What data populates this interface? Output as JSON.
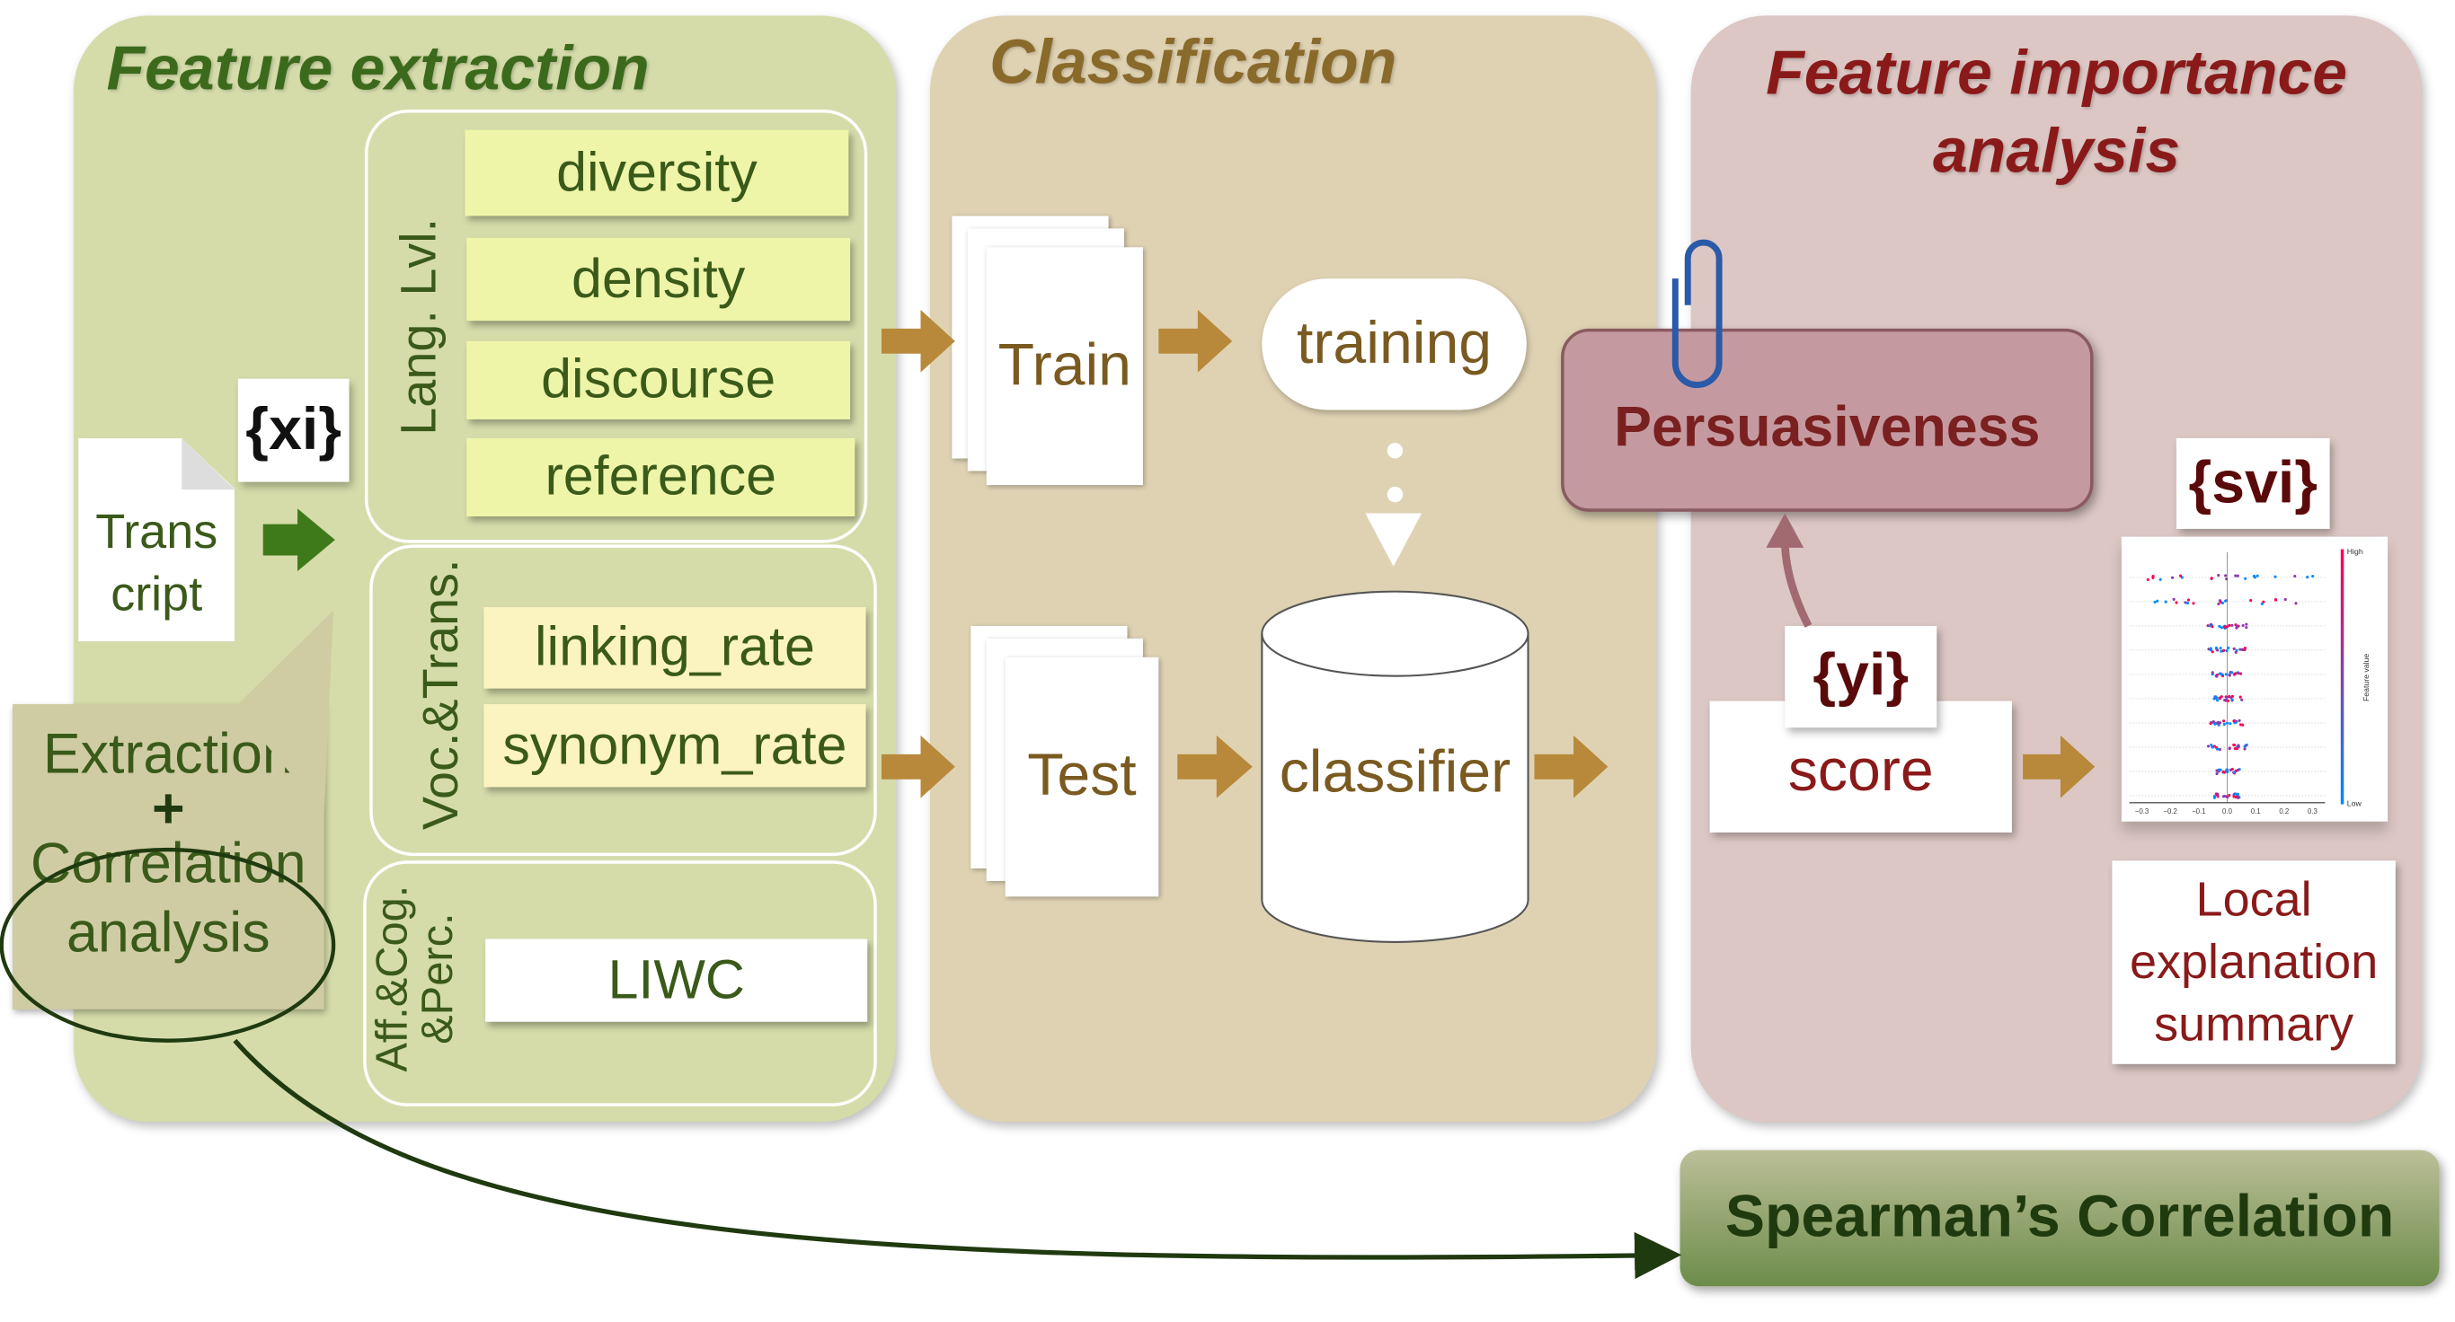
{
  "feature_extraction": {
    "title": "Feature extraction",
    "groups": [
      {
        "label": "Lang. Lvl.",
        "features": [
          "diversity",
          "density",
          "discourse",
          "reference"
        ]
      },
      {
        "label": "Voc.&Trans.",
        "features": [
          "linking_rate",
          "synonym_rate"
        ]
      },
      {
        "label_line1": "Aff.&Cog.",
        "label_line2": "&Perc.",
        "features": [
          "LIWC"
        ]
      }
    ],
    "transcript_line1": "Trans",
    "transcript_line2": "cript",
    "xi": "{xi}",
    "callout": {
      "line1": "Extraction",
      "plus": "+",
      "line2": "Correlation",
      "line3": "analysis"
    }
  },
  "classification": {
    "title": "Classification",
    "train": "Train",
    "test": "Test",
    "training": "training",
    "classifier": "classifier"
  },
  "feature_importance": {
    "title_line1": "Feature importance",
    "title_line2": "analysis",
    "persuasiveness": "Persuasiveness",
    "yi": "{yi}",
    "score": "score",
    "svi": "{svi}",
    "local_line1": "Local",
    "local_line2": "explanation",
    "local_line3": "summary",
    "shap_plot": {
      "x_ticks": [
        "−0.3",
        "−0.2",
        "−0.1",
        "0.0",
        "0.1",
        "0.2",
        "0.3"
      ],
      "colorbar_high": "High",
      "colorbar_low": "Low",
      "colorbar_label": "Feature value",
      "color_high": "#ff0052",
      "color_low": "#008bfb"
    }
  },
  "spearman": "Spearman’s Correlation",
  "colors": {
    "green_panel": "#d5dcaa",
    "classification_panel": "#dfd2b3",
    "importance_panel": "#dcc7c4",
    "arrow": "#b8893a",
    "green_arrow": "#3f7a1a"
  }
}
